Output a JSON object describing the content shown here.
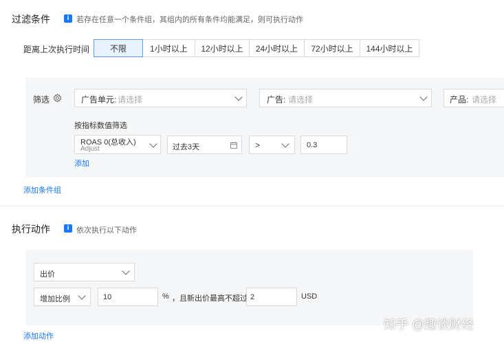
{
  "filter": {
    "title": "过滤条件",
    "info_icon": "i",
    "hint": "若存在任意一个条件组，其组内的所有条件均能满足，则可执行动作",
    "last_exec_label": "距离上次执行时间",
    "time_options": [
      "不限",
      "1小时以上",
      "12小时以上",
      "24小时以上",
      "72小时以上",
      "144小时以上"
    ],
    "selected_option": "不限",
    "screen_label": "筛选",
    "ad_unit_label": "广告单元:",
    "ad_unit_placeholder": "请选择",
    "ad_label": "广告:",
    "ad_placeholder": "请选择",
    "product_label": "产品:",
    "product_placeholder": "请选择",
    "metric_section_label": "按指标数值筛选",
    "metric_name": "ROAS 0(总收入)",
    "metric_source": "Adjust",
    "period": "过去3天",
    "operator": ">",
    "threshold": "0.3",
    "add_link": "添加",
    "add_group_link": "添加条件组"
  },
  "action": {
    "title": "执行动作",
    "info_icon": "i",
    "hint": "依次执行以下动作",
    "action_type": "出价",
    "adjust_mode": "增加比例",
    "percent_value": "10",
    "percent_unit": "%",
    "cap_text": "，且新出价最高不超过",
    "cap_value": "2",
    "currency": "USD",
    "add_action_link": "添加动作"
  },
  "watermark": "知乎 @趣谈财经"
}
